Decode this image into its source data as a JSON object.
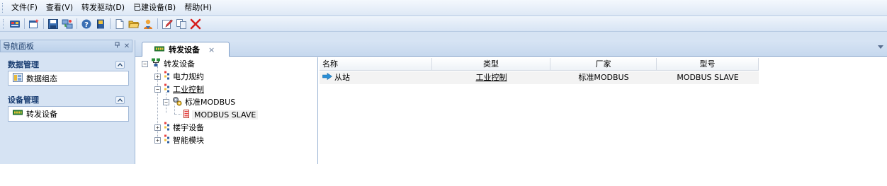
{
  "menu": {
    "items": [
      "文件(F)",
      "查看(V)",
      "转发驱动(D)",
      "已建设备(B)",
      "帮助(H)"
    ]
  },
  "toolbar": {
    "icons": [
      "connect-icon",
      "new-window-icon",
      "save-icon",
      "network-icon",
      "help-icon",
      "book-icon",
      "new-file-icon",
      "open-folder-icon",
      "user-icon",
      "edit-icon",
      "copy-icon",
      "delete-icon"
    ]
  },
  "nav": {
    "title": "导航面板",
    "pin": "ᵖ",
    "close": "✕",
    "groups": [
      {
        "title": "数据管理",
        "entry": "数据组态"
      },
      {
        "title": "设备管理",
        "entry": "转发设备"
      }
    ]
  },
  "tab": {
    "label": "转发设备",
    "close": "×"
  },
  "tree": {
    "root": "转发设备",
    "nodes": {
      "power": "电力规约",
      "industrial": "工业控制",
      "modbus": "标准MODBUS",
      "slave": "MODBUS SLAVE",
      "building": "楼宇设备",
      "smart": "智能模块"
    }
  },
  "list": {
    "columns": [
      "名称",
      "类型",
      "厂家",
      "型号"
    ],
    "rows": [
      {
        "name": "从站",
        "type": "工业控制",
        "vendor": "标准MODBUS",
        "model": "MODBUS SLAVE"
      }
    ]
  },
  "colors": {
    "accent": "#1a3e72",
    "arrow": "#2a8fd6",
    "delete": "#d62020"
  }
}
